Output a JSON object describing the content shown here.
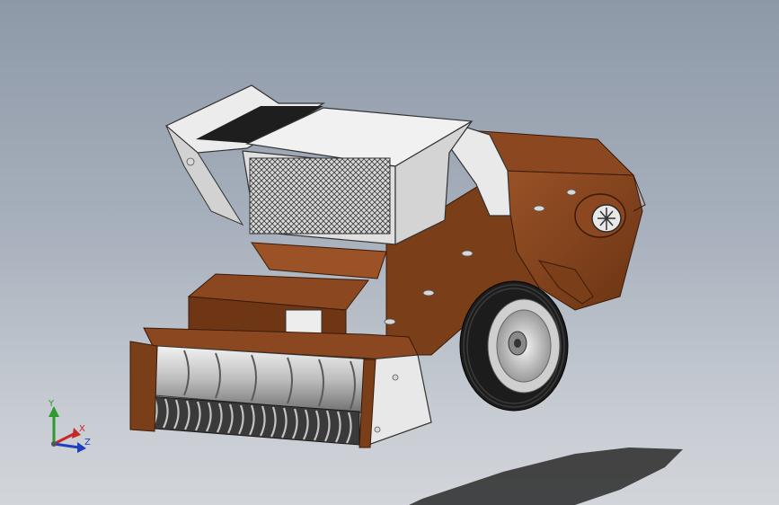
{
  "viewport": {
    "background_top": "#8e99a8",
    "background_bottom": "#d2d5da"
  },
  "model": {
    "body_color": "#7a3e19",
    "body_highlight": "#9a5226",
    "panel_color": "#e6e6e6",
    "tire_color": "#1c1c1c",
    "shadow_color": "#2a2a2a"
  },
  "triad": {
    "y_label": "Y",
    "x_label": "X",
    "z_label": "Z",
    "y_color": "#2e9a2e",
    "x_color": "#c62828",
    "z_color": "#1f3fbf"
  }
}
